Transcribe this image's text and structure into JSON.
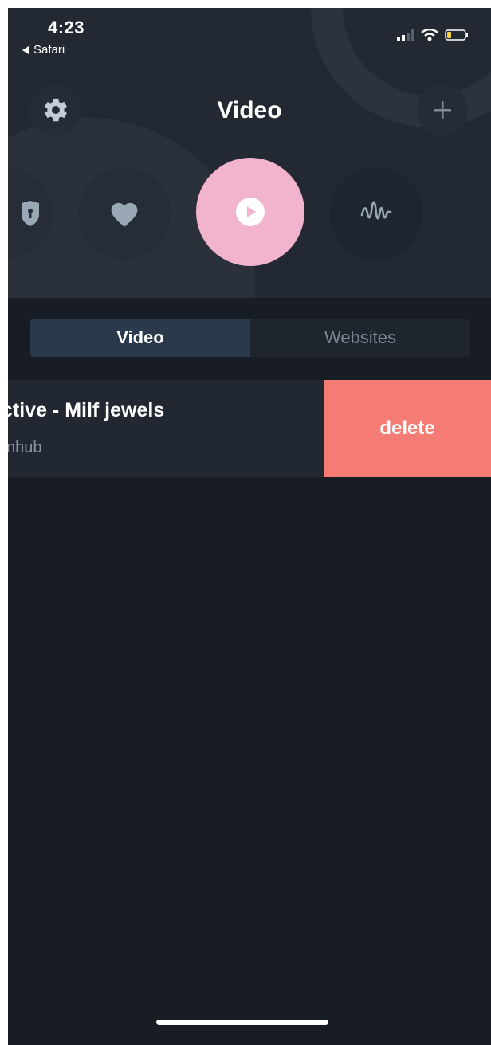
{
  "status_bar": {
    "time": "4:23",
    "back_app": "Safari"
  },
  "header": {
    "title": "Video",
    "settings_icon": "gear-icon",
    "add_icon": "plus-icon"
  },
  "categories": [
    {
      "name": "partial-category",
      "icon": "partial-icon"
    },
    {
      "name": "favorites",
      "icon": "heart-icon"
    },
    {
      "name": "video",
      "icon": "play-icon",
      "active": true
    },
    {
      "name": "audio",
      "icon": "waveform-icon"
    }
  ],
  "tabs": [
    {
      "label": "Video",
      "active": true
    },
    {
      "label": "Websites",
      "active": false
    }
  ],
  "list": [
    {
      "title": "ctive - Milf jewels",
      "subtitle": "nhub",
      "action_label": "delete"
    }
  ],
  "colors": {
    "background": "#181c24",
    "header_background": "#222933",
    "accent_pink": "#f2b4cc",
    "delete_red": "#f47c74",
    "segment_active": "#2a3a4c",
    "battery_low": "#f7d23a"
  }
}
